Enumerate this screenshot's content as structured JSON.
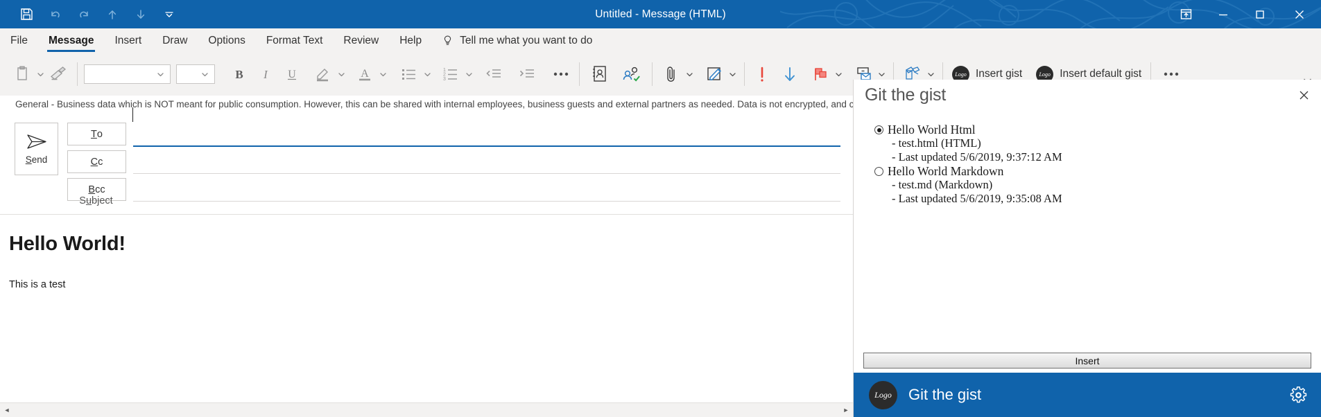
{
  "window": {
    "title": "Untitled  -  Message (HTML)",
    "quick_access": [
      {
        "name": "save-icon",
        "label": "Save"
      },
      {
        "name": "undo-icon",
        "label": "Undo"
      },
      {
        "name": "redo-icon",
        "label": "Redo"
      },
      {
        "name": "previous-item-icon",
        "label": "Previous Item"
      },
      {
        "name": "next-item-icon",
        "label": "Next Item"
      },
      {
        "name": "customize-quick-access-toolbar-icon",
        "label": "Customize Quick Access Toolbar"
      }
    ],
    "controls": [
      {
        "name": "ribbon-display-options-icon",
        "label": "Ribbon Display Options"
      },
      {
        "name": "minimize-icon",
        "label": "Minimize"
      },
      {
        "name": "maximize-icon",
        "label": "Maximize"
      },
      {
        "name": "close-icon",
        "label": "Close"
      }
    ],
    "accent_color": "#1063ab"
  },
  "ribbon": {
    "tabs": [
      {
        "label": "File",
        "active": false
      },
      {
        "label": "Message",
        "active": true
      },
      {
        "label": "Insert",
        "active": false
      },
      {
        "label": "Draw",
        "active": false
      },
      {
        "label": "Options",
        "active": false
      },
      {
        "label": "Format Text",
        "active": false
      },
      {
        "label": "Review",
        "active": false
      },
      {
        "label": "Help",
        "active": false
      }
    ],
    "tell_me": "Tell me what you want to do",
    "collapse_label": "Collapse the Ribbon"
  },
  "toolbar": {
    "paste_label": "Paste",
    "format_painter_label": "Format Painter",
    "font_value": "",
    "font_placeholder": "",
    "font_size_value": "",
    "bold_label": "Bold",
    "italic_label": "Italic",
    "underline_label": "Underline",
    "highlight_label": "Text Highlight Color",
    "font_color_label": "Font Color",
    "bullets_label": "Bullets",
    "numbering_label": "Numbering",
    "decrease_indent_label": "Decrease Indent",
    "increase_indent_label": "Increase Indent",
    "more_formatting_label": "More Formatting Options",
    "address_book_label": "Address Book",
    "check_names_label": "Check Names",
    "attach_file_label": "Attach File",
    "signature_label": "Signature",
    "high_importance_label": "High Importance",
    "low_importance_label": "Low Importance",
    "follow_up_label": "Follow Up",
    "move_label": "Move",
    "addins_label": "Add-ins",
    "insert_gist_label": "Insert gist",
    "insert_default_gist_label": "Insert default gist",
    "logo_text": "Logo",
    "overflow_label": "More Commands"
  },
  "info_bar": {
    "icon": "info-icon",
    "text": "General - Business data which is NOT meant for public consumption. However, this can be shared with internal employees, business guests and external partners as needed. Data is not encrypted, and cannot be tracked or revoked."
  },
  "compose": {
    "send_label": "Send",
    "send_accel": "S",
    "send_rest": "end",
    "to_accel": "T",
    "to_rest": "o",
    "cc_accel": "C",
    "cc_rest": "c",
    "bcc_accel": "B",
    "bcc_rest": "cc",
    "subject_pre": "S",
    "subject_accel": "u",
    "subject_rest": "bject",
    "to_value": "",
    "cc_value": "",
    "bcc_value": "",
    "subject_value": ""
  },
  "message_body": {
    "heading": "Hello World!",
    "paragraph": "This is a test"
  },
  "task_pane": {
    "title": "Git the gist",
    "close_label": "Close",
    "items": [
      {
        "name": "Hello World Html",
        "file": "- test.html (HTML)",
        "updated": "- Last updated 5/6/2019, 9:37:12 AM",
        "selected": true
      },
      {
        "name": "Hello World Markdown",
        "file": "- test.md (Markdown)",
        "updated": "- Last updated 5/6/2019, 9:35:08 AM",
        "selected": false
      }
    ],
    "insert_button": "Insert",
    "footer": {
      "logo_text": "Logo",
      "name": "Git the gist",
      "settings_label": "Settings",
      "background": "#1063ab"
    }
  }
}
